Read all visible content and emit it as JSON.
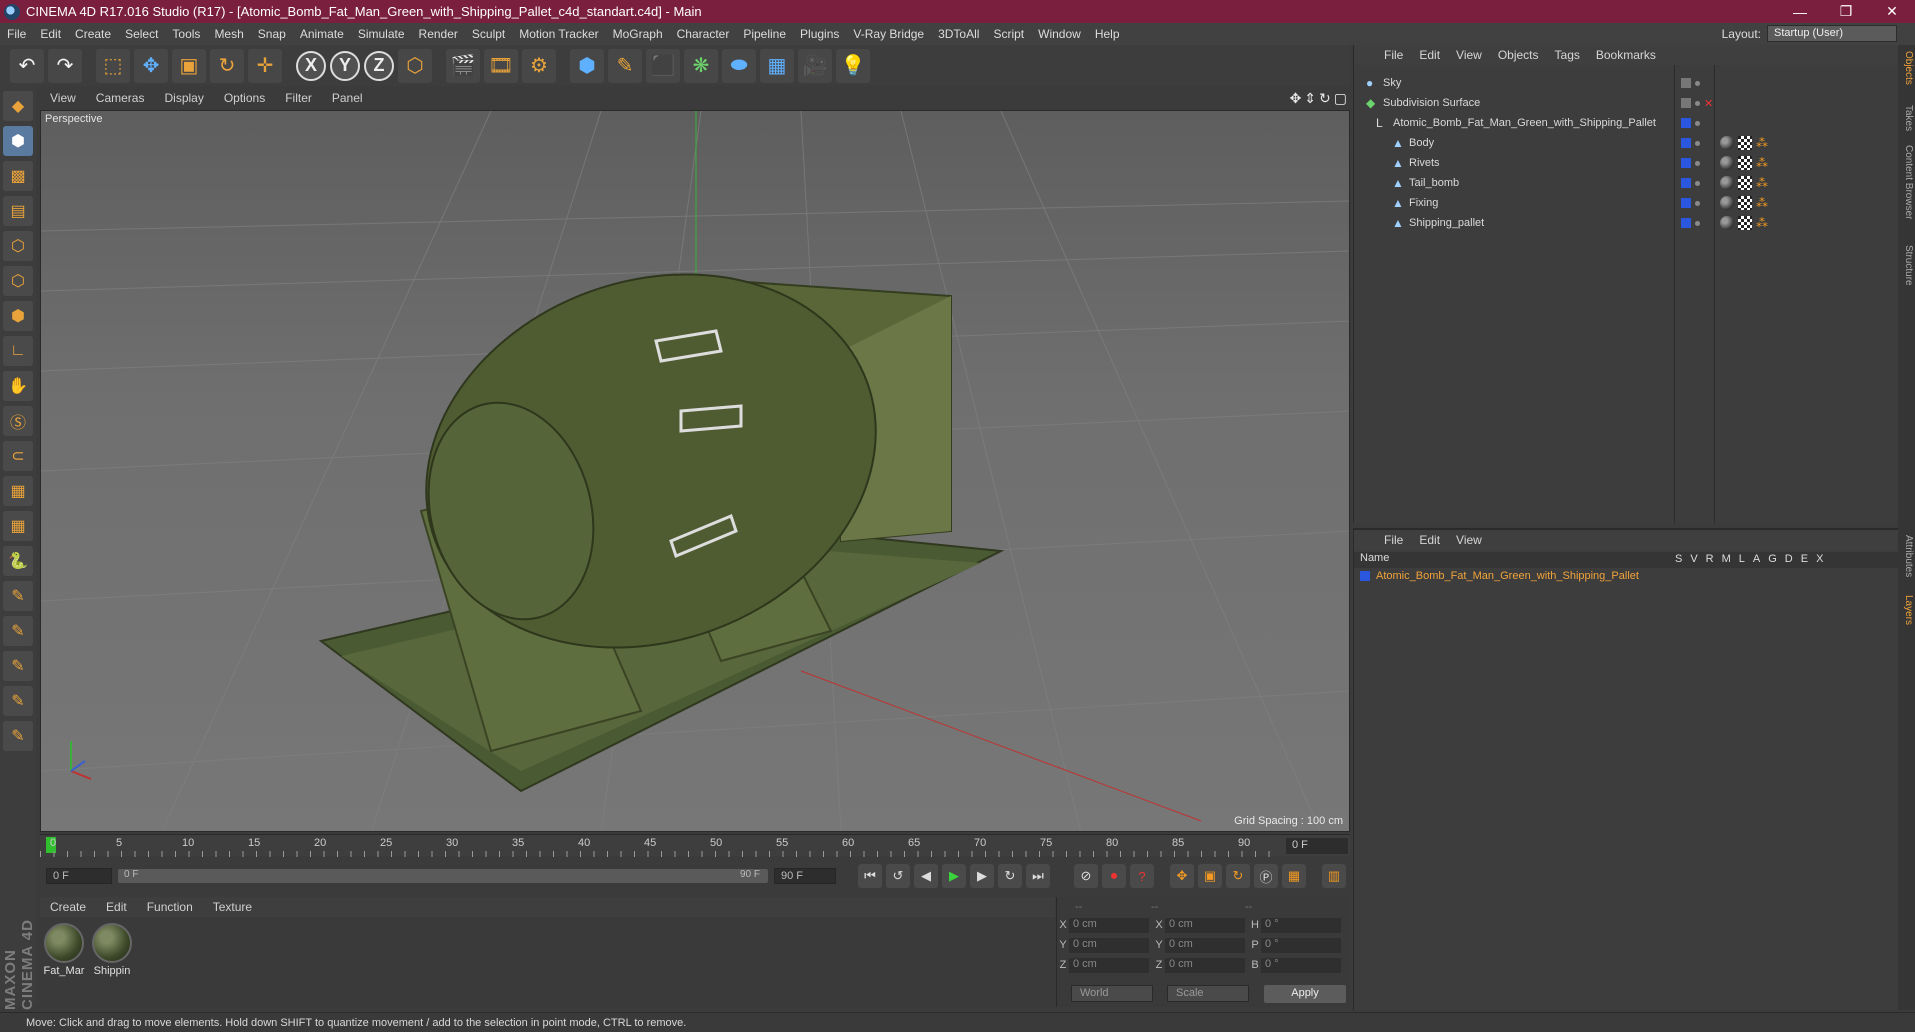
{
  "window": {
    "title": "CINEMA 4D R17.016 Studio (R17) - [Atomic_Bomb_Fat_Man_Green_with_Shipping_Pallet_c4d_standart.c4d] - Main",
    "min": "—",
    "max": "❐",
    "close": "✕"
  },
  "menu": [
    "File",
    "Edit",
    "Create",
    "Select",
    "Tools",
    "Mesh",
    "Snap",
    "Animate",
    "Simulate",
    "Render",
    "Sculpt",
    "Motion Tracker",
    "MoGraph",
    "Character",
    "Pipeline",
    "Plugins",
    "V-Ray Bridge",
    "3DToAll",
    "Script",
    "Window",
    "Help"
  ],
  "layout": {
    "label": "Layout:",
    "value": "Startup (User)"
  },
  "viewport": {
    "menu": [
      "View",
      "Cameras",
      "Display",
      "Options",
      "Filter",
      "Panel"
    ],
    "label": "Perspective",
    "grid_spacing": "Grid Spacing : 100 cm"
  },
  "timeline": {
    "ticks": [
      "0",
      "5",
      "10",
      "15",
      "20",
      "25",
      "30",
      "35",
      "40",
      "45",
      "50",
      "55",
      "60",
      "65",
      "70",
      "75",
      "80",
      "85",
      "90"
    ],
    "current_frame": "0 F"
  },
  "transport": {
    "start": "0 F",
    "range_start": "0 F",
    "range_end": "90 F",
    "end": "90 F"
  },
  "materials": {
    "menu": [
      "Create",
      "Edit",
      "Function",
      "Texture"
    ],
    "items": [
      {
        "name": "Fat_Mar"
      },
      {
        "name": "Shippin"
      }
    ]
  },
  "coords": {
    "header": [
      "--",
      "--",
      "--"
    ],
    "rows": [
      {
        "a": "X",
        "av": "0 cm",
        "b": "X",
        "bv": "0 cm",
        "c": "H",
        "cv": "0 °"
      },
      {
        "a": "Y",
        "av": "0 cm",
        "b": "Y",
        "bv": "0 cm",
        "c": "P",
        "cv": "0 °"
      },
      {
        "a": "Z",
        "av": "0 cm",
        "b": "Z",
        "bv": "0 cm",
        "c": "B",
        "cv": "0 °"
      }
    ],
    "world": "World",
    "scale": "Scale",
    "apply": "Apply"
  },
  "status": "Move: Click and drag to move elements. Hold down SHIFT to quantize movement / add to the selection in point mode, CTRL to remove.",
  "object_manager": {
    "menu": [
      "File",
      "Edit",
      "View",
      "Objects",
      "Tags",
      "Bookmarks"
    ],
    "objects": [
      {
        "name": "Sky"
      },
      {
        "name": "Subdivision Surface"
      },
      {
        "name": "Atomic_Bomb_Fat_Man_Green_with_Shipping_Pallet"
      },
      {
        "name": "Body"
      },
      {
        "name": "Rivets"
      },
      {
        "name": "Tail_bomb"
      },
      {
        "name": "Fixing"
      },
      {
        "name": "Shipping_pallet"
      }
    ]
  },
  "layer_manager": {
    "menu": [
      "File",
      "Edit",
      "View"
    ],
    "name_col": "Name",
    "cols": "SVRMLAGDEX",
    "layer": "Atomic_Bomb_Fat_Man_Green_with_Shipping_Pallet"
  },
  "right_tabs": [
    "Objects",
    "Takes",
    "Content Browser",
    "Structure",
    "Attributes",
    "Layers"
  ],
  "logo_text": "MAXON CINEMA 4D"
}
